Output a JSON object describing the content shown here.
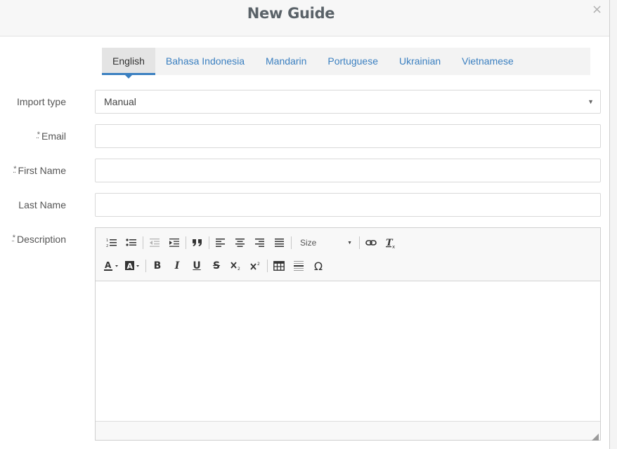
{
  "modal": {
    "title": "New Guide",
    "close_label": "×"
  },
  "tabs": [
    {
      "label": "English",
      "active": true
    },
    {
      "label": "Bahasa Indonesia",
      "active": false
    },
    {
      "label": "Mandarin",
      "active": false
    },
    {
      "label": "Portuguese",
      "active": false
    },
    {
      "label": "Ukrainian",
      "active": false
    },
    {
      "label": "Vietnamese",
      "active": false
    }
  ],
  "form": {
    "import_type": {
      "label": "Import type",
      "value": "Manual"
    },
    "email": {
      "required_mark": "*",
      "label": "Email",
      "value": ""
    },
    "first_name": {
      "required_mark": "*",
      "label": "First Name",
      "value": ""
    },
    "last_name": {
      "label": "Last Name",
      "value": ""
    },
    "description": {
      "required_mark": "*",
      "label": "Description",
      "value": ""
    }
  },
  "editor": {
    "size_label": "Size",
    "toolbar_row1_icons": [
      "numbered-list-icon",
      "bulleted-list-icon",
      "decrease-indent-icon",
      "increase-indent-icon",
      "blockquote-icon",
      "align-left-icon",
      "align-center-icon",
      "align-right-icon",
      "justify-icon",
      "size-dropdown",
      "link-icon",
      "remove-format-icon"
    ],
    "toolbar_row2_icons": [
      "text-color-icon",
      "background-color-icon",
      "bold-icon",
      "italic-icon",
      "underline-icon",
      "strikethrough-icon",
      "subscript-icon",
      "superscript-icon",
      "table-icon",
      "horizontal-line-icon",
      "special-character-icon"
    ],
    "glyphs": {
      "bold": "B",
      "italic": "I",
      "underline": "U",
      "strike": "S",
      "omega": "Ω"
    }
  },
  "colors": {
    "accent": "#3a7fc0",
    "title": "#5a6268"
  }
}
